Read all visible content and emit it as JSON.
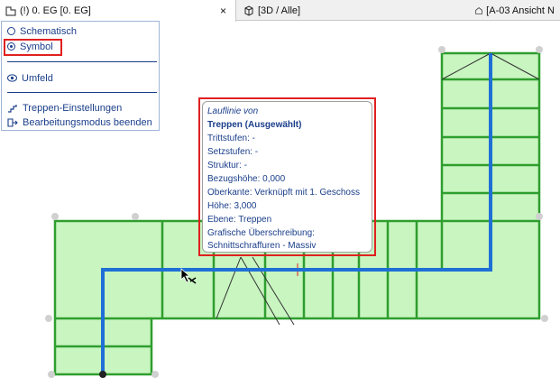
{
  "tabs": [
    {
      "label": "(!) 0. EG [0. EG]",
      "icon": "floorplan-icon",
      "active": true,
      "close": "×"
    },
    {
      "label": "[3D / Alle]",
      "icon": "3d-cube-icon",
      "active": false
    },
    {
      "label": "[A-03 Ansicht N",
      "icon": "elevation-icon",
      "active": false
    }
  ],
  "panel": {
    "schematic": "Schematisch",
    "symbol": "Symbol",
    "environment": "Umfeld",
    "settings": "Treppen-Einstellungen",
    "exit_edit": "Bearbeitungsmodus beenden"
  },
  "tooltip": {
    "heading": "Lauflinie von",
    "title": "Treppen (Ausgewählt)",
    "lines": [
      "Trittstufen: -",
      "Setzstufen: -",
      "Struktur: -",
      "Bezugshöhe: 0,000",
      "Oberkante: Verknüpft mit 1. Geschoss",
      "Höhe: 3,000",
      "Ebene: Treppen",
      "Grafische Überschreibung:",
      "Schnittschraffuren - Massiv"
    ]
  },
  "colors": {
    "stair_fill": "#c8f5c0",
    "stair_line": "#2e9e2e",
    "walk_line": "#1f6fd6",
    "highlight": "#e02020",
    "panel_text": "#1a3e8a"
  }
}
